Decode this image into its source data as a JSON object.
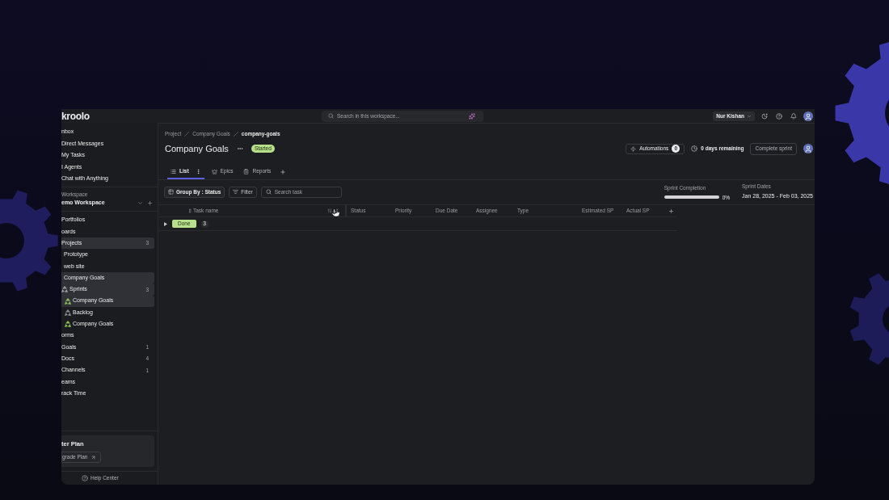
{
  "topbar": {
    "logo": "kroolo",
    "search": {
      "placeholder": "Search in this workspace..."
    },
    "user": {
      "name": "Nur Kishan"
    }
  },
  "sidebar": {
    "top_items": [
      "nbox",
      "Direct Messages",
      "My Tasks",
      "I Agents",
      "Chat with Anything"
    ],
    "workspace": {
      "label": "Workspace",
      "name": "emo Workspace"
    },
    "items": [
      {
        "label": "Portfolios",
        "kind": "page",
        "selected": false
      },
      {
        "label": "oards",
        "kind": "page",
        "selected": false
      },
      {
        "label": "Projects",
        "kind": "page",
        "count": "3",
        "selected": true,
        "children": [
          {
            "label": "Prototype",
            "kind": "page",
            "selected": false
          },
          {
            "label": "web site",
            "kind": "page",
            "selected": false
          },
          {
            "label": "Company Goals",
            "kind": "page",
            "selected": true,
            "children": [
              {
                "label": "Sprints",
                "kind": "sprint",
                "color": "#9a9aa0",
                "count": "3",
                "selected": true,
                "children": [
                  {
                    "label": "Company Goals",
                    "kind": "sprint",
                    "color": "#8fbf5a",
                    "selected": true
                  },
                  {
                    "label": "Backlog",
                    "kind": "sprint",
                    "color": "#8a8a90",
                    "selected": false
                  },
                  {
                    "label": "Company Goals",
                    "kind": "sprint",
                    "color": "#8fbf5a",
                    "selected": false
                  }
                ]
              }
            ]
          }
        ]
      },
      {
        "label": "orms",
        "kind": "page",
        "selected": false
      },
      {
        "label": "Goals",
        "kind": "page",
        "count": "1",
        "selected": false
      },
      {
        "label": "Docs",
        "kind": "page",
        "count": "4",
        "selected": false
      },
      {
        "label": "Channels",
        "kind": "page",
        "count": "1",
        "selected": false
      },
      {
        "label": "eams",
        "kind": "page",
        "selected": false
      },
      {
        "label": "rack Time",
        "kind": "page",
        "selected": false
      }
    ],
    "plan": {
      "title": "ter Plan",
      "button": "grade Plan"
    },
    "help": "Help Center"
  },
  "breadcrumb": [
    "Project",
    "Company Goals",
    "company-goals"
  ],
  "header": {
    "title": "Company Goals",
    "status": "Started",
    "automations": {
      "label": "Automations",
      "count": "0"
    },
    "remaining": "0 days remaining",
    "complete_button": "Complete sprint"
  },
  "tabs": [
    {
      "label": "List",
      "kind": "list",
      "selected": true
    },
    {
      "label": "Epics",
      "kind": "epics",
      "selected": false
    },
    {
      "label": "Reports",
      "kind": "reports",
      "selected": false
    }
  ],
  "toolbar": {
    "group_by": "Group By : Status",
    "filter": "Filter",
    "search": {
      "placeholder": "Search task"
    }
  },
  "sprint": {
    "completion_label": "Sprint Completion",
    "level": 0,
    "reading": "0%",
    "dates_label": "Sprint Dates",
    "dates": "Jan 28, 2025 - Feb 03, 2025"
  },
  "table": {
    "columns": [
      "Task name",
      "Status",
      "Priority",
      "Due Date",
      "Assignee",
      "Type",
      "Estimated SP",
      "Actual SP"
    ],
    "groups": [
      {
        "label": "Done",
        "count": "3",
        "color": "#b8e08a",
        "expanded": false
      }
    ]
  }
}
